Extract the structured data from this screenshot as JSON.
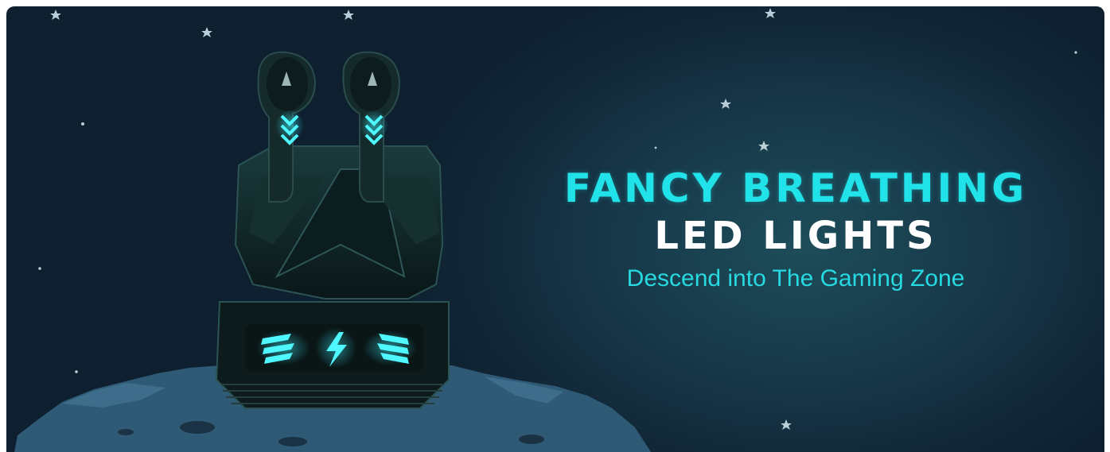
{
  "banner": {
    "headline_line1": "FANCY BREATHING",
    "headline_line2": "LED LIGHTS",
    "tagline": "Descend into The Gaming Zone"
  },
  "colors": {
    "accent_cyan": "#20e2e8",
    "background_dark": "#112737",
    "rock": "#2f5a76"
  },
  "icons": [
    "earbud-icon",
    "charging-case-icon",
    "lightning-bolt-icon",
    "star-icon"
  ]
}
